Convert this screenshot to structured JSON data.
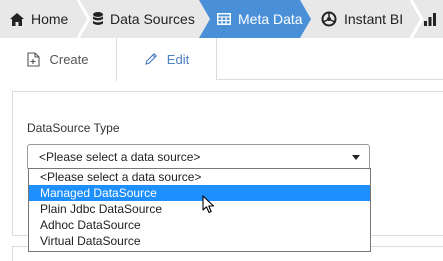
{
  "breadcrumbs": [
    {
      "label": "Home",
      "icon": "home-icon"
    },
    {
      "label": "Data Sources",
      "icon": "database-icon"
    },
    {
      "label": "Meta Data",
      "icon": "table-icon"
    },
    {
      "label": "Instant BI",
      "icon": "chart-wheel-icon"
    }
  ],
  "colors": {
    "crumb_bg": "#e8e8e8",
    "crumb_active": "#4a90d9",
    "option_highlight": "#1e8fff",
    "link_blue": "#4a7fc1"
  },
  "tabs": [
    {
      "label": "Create",
      "icon": "create-doc-icon",
      "active": true
    },
    {
      "label": "Edit",
      "icon": "pencil-icon",
      "active": false
    }
  ],
  "form": {
    "label": "DataSource Type",
    "selected": "<Please select a data source>",
    "options": [
      "<Please select a data source>",
      "Managed DataSource",
      "Plain Jdbc DataSource",
      "Adhoc DataSource",
      "Virtual DataSource"
    ],
    "highlighted_option": "Managed DataSource"
  }
}
